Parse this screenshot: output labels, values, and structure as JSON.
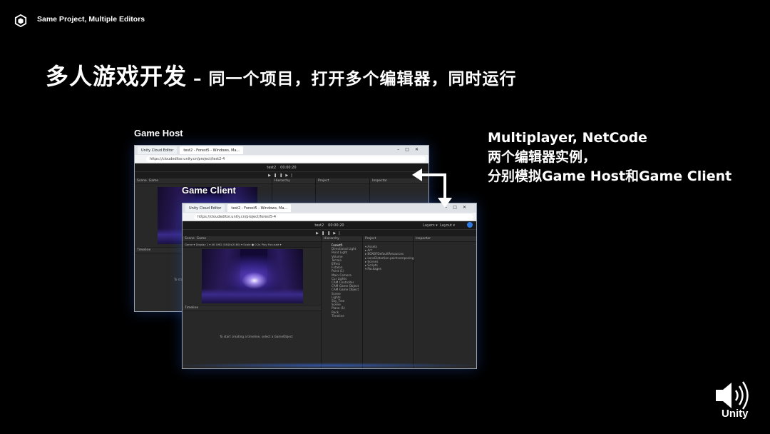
{
  "header": {
    "title": "Same Project, Multiple Editors",
    "logo_icon": "unity-cube-icon"
  },
  "main_title": {
    "text": "多人游戏开发",
    "subtitle": " – 同一个项目，打开多个编辑器，同时运行"
  },
  "labels": {
    "game_host": "Game Host",
    "game_client": "Game Client"
  },
  "right_text": {
    "line1": "Multiplayer, NetCode",
    "line2": "两个编辑器实例，",
    "line3": "分别模拟Game Host和Game Client"
  },
  "host_window": {
    "tab1": "Unity Cloud Editor",
    "tab2": "test2 - Forest5 - Windows, Ma...",
    "url": "https://cloudeditor.unity.cn/project/test2-4",
    "project": "test2",
    "timer": "00:00:20",
    "scene_tab": "Scene",
    "game_tab": "Game",
    "hierarchy_tab": "Hierarchy",
    "project_tab": "Project",
    "inspector_tab": "Inspector",
    "timeline_tab": "Timeline",
    "timeline_hint": "To start"
  },
  "client_window": {
    "tab1": "Unity Cloud Editor",
    "tab2": "test2 - Forest5 - Windows, Ma...",
    "url": "https://cloudeditor.unity.cn/project/forest5-4",
    "project": "test2",
    "timer": "00:00:20",
    "layers": "Layers",
    "layout": "Layout",
    "scene_tab": "Scene",
    "game_tab": "Game",
    "game_bar": "Game  ▾  Display 1  ▾  4K UHD (3840x2160)  ▾   Scale ●  0.2x    Play Focused  ▾",
    "hierarchy_tab": "Hierarchy",
    "project_tab": "Project",
    "inspector_tab": "Inspector",
    "timeline_tab": "Timeline",
    "timeline_hint": "To start creating a timeline, select a GameObject",
    "hierarchy_items": [
      "Forest5",
      "Directional Light",
      "Point Light",
      "Volume",
      "Terrain",
      "Effect",
      "Fxtalon",
      "Point (1)",
      "Main Camera",
      "Cur Lights",
      "CAM Controller",
      "CAM Game Object",
      "CAM Game Object",
      "Scene",
      "Lights",
      "Sky_Tree",
      "Scene",
      "Plane (1)",
      "Rock",
      "Timeline"
    ],
    "project_items": [
      "Assets",
      "Art",
      "BOXBFDefaultResources",
      "LensDistortion.pointcomposing",
      "Scenes",
      "Scripts",
      "Packages"
    ]
  },
  "icons": {
    "audio": "speaker-icon",
    "arrow": "double-arrow-icon"
  },
  "footer": {
    "brand": "Unity"
  }
}
